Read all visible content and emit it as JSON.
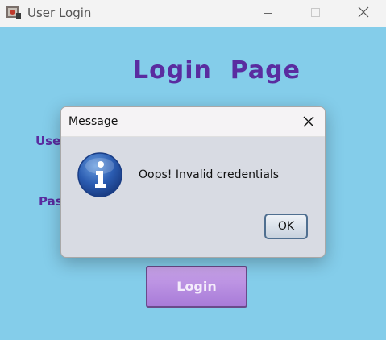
{
  "window": {
    "title": "User Login",
    "background_color": "#84cdea"
  },
  "main": {
    "heading": "Login  Page",
    "username_label": "Use",
    "password_label": "Pas",
    "login_button_label": "Login",
    "accent_color": "#5a2ca0"
  },
  "dialog": {
    "title": "Message",
    "message": "Oops! Invalid credentials",
    "ok_label": "OK",
    "icon": "info-icon"
  },
  "icons": {
    "app": "java-cup-icon",
    "minimize": "minimize-icon",
    "maximize": "maximize-icon",
    "close": "close-icon"
  }
}
